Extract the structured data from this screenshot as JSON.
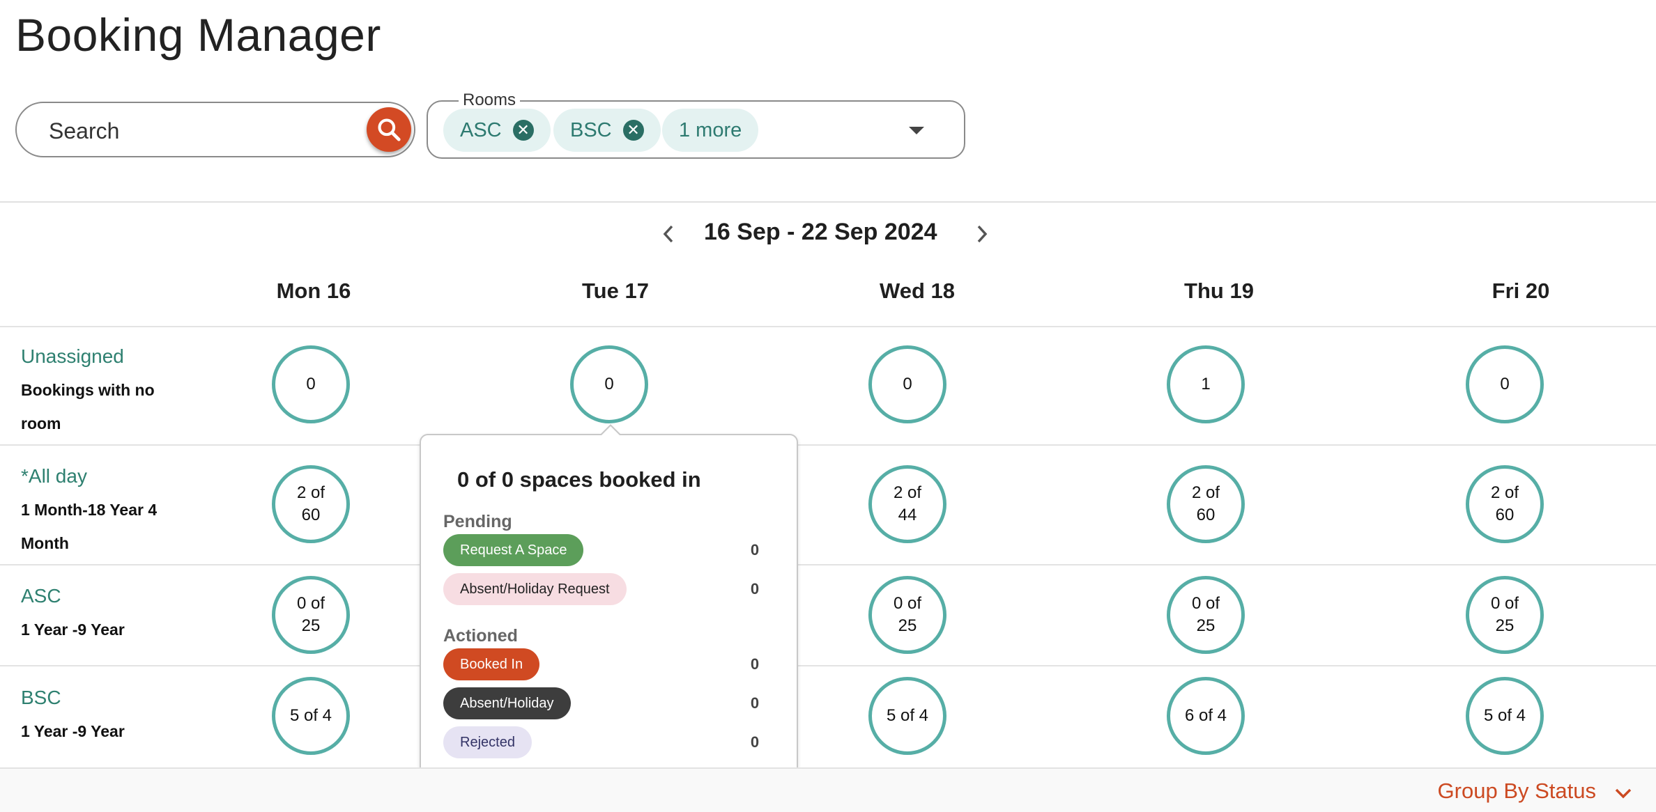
{
  "page": {
    "title": "Booking Manager"
  },
  "search": {
    "placeholder": "Search"
  },
  "rooms_filter": {
    "label": "Rooms",
    "chips": [
      {
        "label": "ASC"
      },
      {
        "label": "BSC"
      }
    ],
    "more_label": "1 more"
  },
  "week": {
    "range_label": "16 Sep - 22 Sep 2024"
  },
  "days": [
    "Mon 16",
    "Tue 17",
    "Wed 18",
    "Thu 19",
    "Fri 20"
  ],
  "rows": [
    {
      "title": "Unassigned",
      "subtitle": "Bookings with no room",
      "counts": [
        "0",
        "0",
        "0",
        "1",
        "0"
      ]
    },
    {
      "title": "*All day",
      "subtitle": "1 Month-18 Year 4 Month",
      "counts": [
        "2 of 60",
        "",
        "2 of 44",
        "2 of 60",
        "2 of 60"
      ]
    },
    {
      "title": "ASC",
      "subtitle": "1 Year -9 Year",
      "counts": [
        "0 of 25",
        "",
        "0 of 25",
        "0 of 25",
        "0 of 25"
      ]
    },
    {
      "title": "BSC",
      "subtitle": "1 Year -9 Year",
      "counts": [
        "5 of 4",
        "",
        "5 of 4",
        "6 of 4",
        "5 of 4"
      ]
    }
  ],
  "popover": {
    "title": "0 of 0 spaces booked in",
    "pending_label": "Pending",
    "actioned_label": "Actioned",
    "items": [
      {
        "label": "Request A Space",
        "count": "0",
        "bg": "#5c9e5a",
        "fg": "#ffffff"
      },
      {
        "label": "Absent/Holiday Request",
        "count": "0",
        "bg": "#f7dde2",
        "fg": "#222222"
      },
      {
        "label": "Booked In",
        "count": "0",
        "bg": "#d04a22",
        "fg": "#ffffff"
      },
      {
        "label": "Absent/Holiday",
        "count": "0",
        "bg": "#3d3d3d",
        "fg": "#ffffff"
      },
      {
        "label": "Rejected",
        "count": "0",
        "bg": "#e6e3f3",
        "fg": "#333366"
      }
    ]
  },
  "footer": {
    "group_by_label": "Group By Status"
  },
  "colors": {
    "accent": "#d34a24",
    "teal": "#56aea6",
    "teal_text": "#2e8070"
  }
}
